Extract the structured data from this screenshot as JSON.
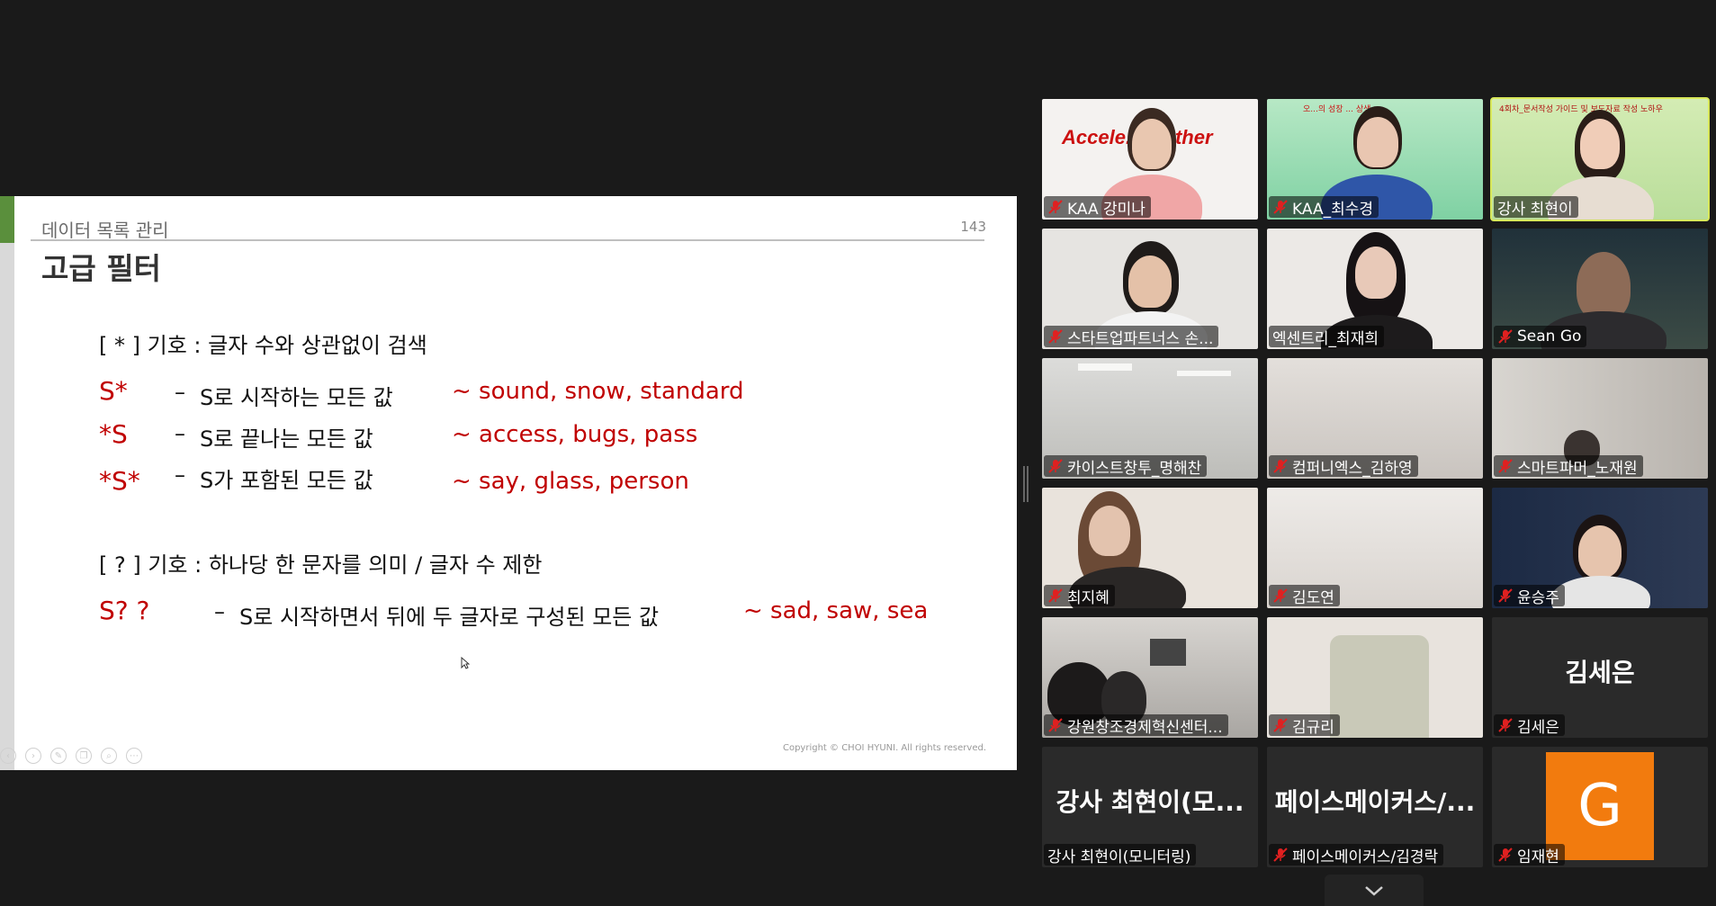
{
  "slide": {
    "section": "데이터 목록 관리",
    "page": "143",
    "title": "고급 필터",
    "star_heading": "[ * ] 기호 : 글자 수와 상관없이 검색",
    "rows": [
      {
        "pattern": "S*",
        "dash": "–",
        "desc": "S로 시작하는 모든 값",
        "example": "~ sound, snow, standard"
      },
      {
        "pattern": "*S",
        "dash": "–",
        "desc": "S로 끝나는 모든 값",
        "example": "~ access, bugs, pass"
      },
      {
        "pattern": "*S*",
        "dash": "–",
        "desc": "S가 포함된 모든 값",
        "example": "~ say, glass, person"
      }
    ],
    "q_heading": "[ ? ] 기호 : 하나당 한 문자를 의미 / 글자 수 제한",
    "q_row": {
      "pattern": "S? ?",
      "dash": "–",
      "desc": "S로 시작하면서 뒤에 두 글자로 구성된 모든 값",
      "example": "~ sad, saw, sea"
    },
    "copyright": "Copyright © CHOI HYUNI. All rights reserved."
  },
  "participants": [
    {
      "name": "KAA 강미나",
      "muted": true
    },
    {
      "name": "KAA_최수경",
      "muted": true
    },
    {
      "name": "강사 최현이",
      "muted": false,
      "active": true
    },
    {
      "name": "스타트업파트너스 손...",
      "muted": true
    },
    {
      "name": "엑센트리_최재희",
      "muted": false
    },
    {
      "name": "Sean Go",
      "muted": true
    },
    {
      "name": "카이스트창투_명해찬",
      "muted": true
    },
    {
      "name": "컴퍼니엑스_김하영",
      "muted": true
    },
    {
      "name": "스마트파머_노재원",
      "muted": true
    },
    {
      "name": "최지혜",
      "muted": true
    },
    {
      "name": "김도연",
      "muted": true
    },
    {
      "name": "윤승주",
      "muted": true
    },
    {
      "name": "강원창조경제혁신센터...",
      "muted": true
    },
    {
      "name": "김규리",
      "muted": true
    },
    {
      "name": "김세은",
      "muted": true,
      "big": "김세은"
    },
    {
      "name": "강사 최현이(모니터링)",
      "muted": false,
      "big": "강사 최현이(모..."
    },
    {
      "name": "페이스메이커스/김경락",
      "muted": true,
      "big": "페이스메이커스/..."
    },
    {
      "name": "임재현",
      "muted": true,
      "avatar": "G"
    }
  ],
  "video_banners": {
    "tile1_text": "Accele... ...ether",
    "tile2_text": "오...의 성장 ... 상생...",
    "tile3_text": "4회차_문서작성 가이드 및 보도자료 작성 노하우"
  }
}
